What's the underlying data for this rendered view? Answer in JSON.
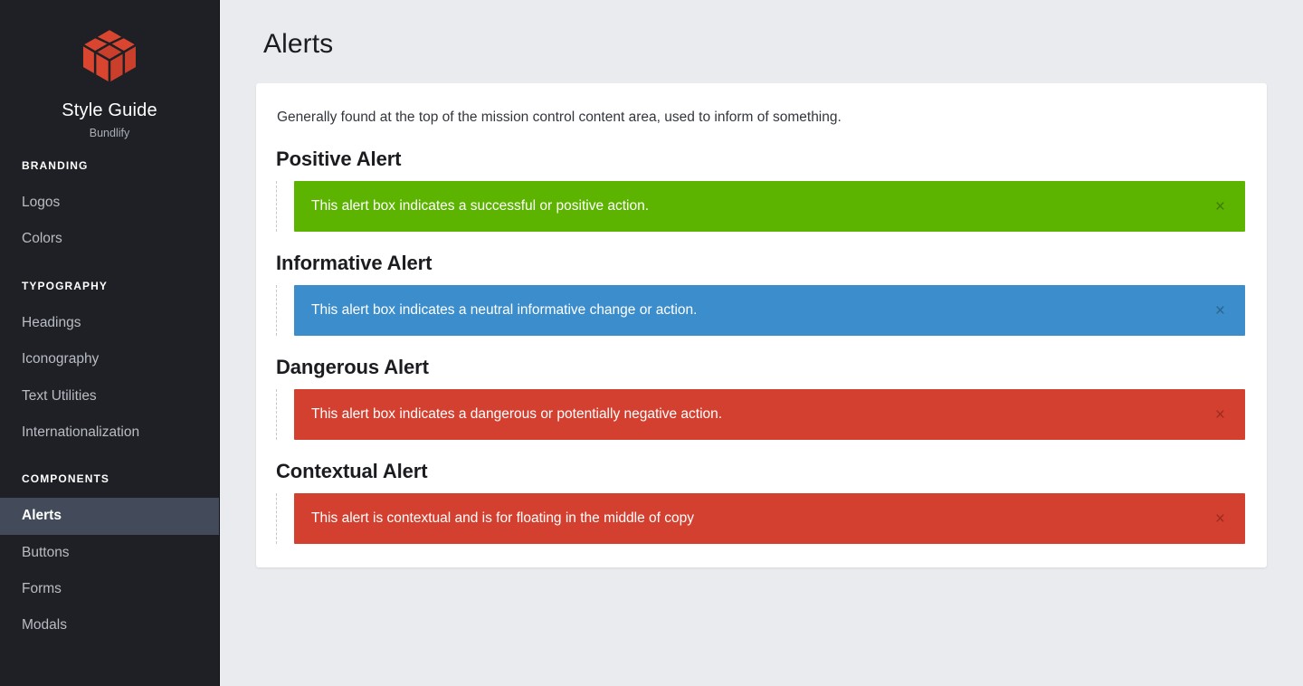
{
  "sidebar": {
    "logo_icon": "cube-logo-icon",
    "brand_title": "Style Guide",
    "brand_subtitle": "Bundlify",
    "sections": [
      {
        "title": "BRANDING",
        "items": [
          {
            "label": "Logos",
            "active": false
          },
          {
            "label": "Colors",
            "active": false
          }
        ]
      },
      {
        "title": "TYPOGRAPHY",
        "items": [
          {
            "label": "Headings",
            "active": false
          },
          {
            "label": "Iconography",
            "active": false
          },
          {
            "label": "Text Utilities",
            "active": false
          },
          {
            "label": "Internationalization",
            "active": false
          }
        ]
      },
      {
        "title": "COMPONENTS",
        "items": [
          {
            "label": "Alerts",
            "active": true
          },
          {
            "label": "Buttons",
            "active": false
          },
          {
            "label": "Forms",
            "active": false
          },
          {
            "label": "Modals",
            "active": false
          }
        ]
      }
    ]
  },
  "main": {
    "page_title": "Alerts",
    "intro": "Generally found at the top of the mission control content area, used to inform of something.",
    "alerts": [
      {
        "heading": "Positive Alert",
        "message": "This alert box indicates a successful or positive action.",
        "variant": "success",
        "color": "#5cb400",
        "close_icon": "close-icon",
        "close_glyph": "×"
      },
      {
        "heading": "Informative Alert",
        "message": "This alert box indicates a neutral informative change or action.",
        "variant": "info",
        "color": "#3b8dcc",
        "close_icon": "close-icon",
        "close_glyph": "×"
      },
      {
        "heading": "Dangerous Alert",
        "message": "This alert box indicates a dangerous or potentially negative action.",
        "variant": "danger",
        "color": "#d44030",
        "close_icon": "close-icon",
        "close_glyph": "×"
      },
      {
        "heading": "Contextual Alert",
        "message": "This alert is contextual and is for floating in the middle of copy",
        "variant": "danger",
        "color": "#d44030",
        "close_icon": "close-icon",
        "close_glyph": "×"
      }
    ]
  },
  "theme": {
    "sidebar_bg": "#1e2025",
    "sidebar_active_bg": "#434a5a",
    "page_bg": "#eaebee",
    "card_bg": "#ffffff",
    "brand_red": "#d9452f"
  }
}
